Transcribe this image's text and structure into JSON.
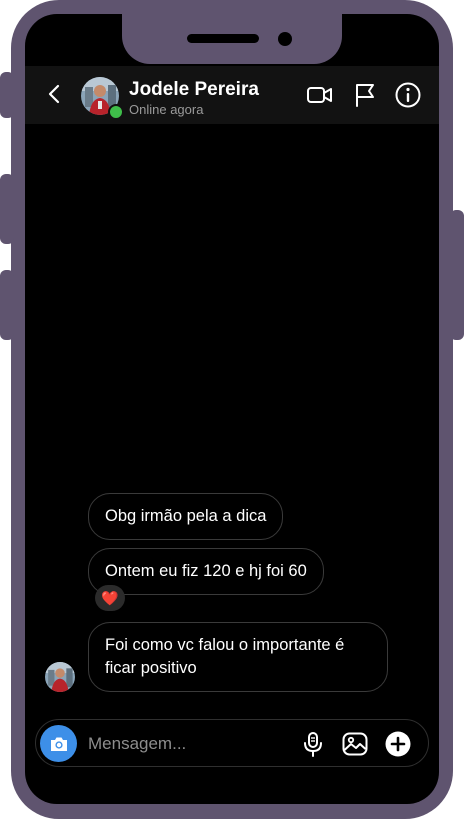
{
  "contact": {
    "name": "Jodele Pereira",
    "status": "Online agora"
  },
  "header_icons": [
    "back-chevron-icon",
    "video-camera-icon",
    "flag-icon",
    "info-icon"
  ],
  "messages": [
    {
      "text": "Obg irmão pela a dica"
    },
    {
      "text": "Ontem eu fiz 120 e hj foi 60",
      "reaction": "❤️"
    },
    {
      "text_line1": "Foi como vc falou o importante é",
      "text_line2": "ficar positivo"
    }
  ],
  "composer": {
    "placeholder": "Mensagem...",
    "icons": [
      "camera-icon",
      "microphone-icon",
      "image-icon",
      "plus-icon"
    ]
  },
  "colors": {
    "frame": "#5f546f",
    "screen": "#000000",
    "header": "#121212",
    "online": "#3fbe4a",
    "camera_button": "#3d8fe8"
  }
}
